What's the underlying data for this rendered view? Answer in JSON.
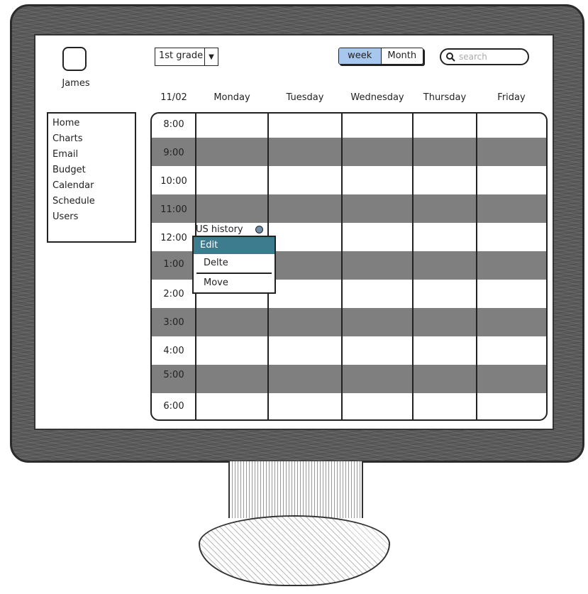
{
  "user": {
    "name": "James"
  },
  "toolbar": {
    "grade_value": "1st grade",
    "view_week": "week",
    "view_month": "Month",
    "active_view": "week",
    "search_placeholder": "search"
  },
  "nav": {
    "items": [
      "Home",
      "Charts",
      "Email",
      "Budget",
      "Calendar",
      "Schedule",
      "Users"
    ]
  },
  "calendar": {
    "date": "11/02",
    "days": [
      "Monday",
      "Tuesday",
      "Wednesday",
      "Thursday",
      "Friday"
    ],
    "times": [
      "8:00",
      "9:00",
      "10:00",
      "11:00",
      "12:00",
      "1:00",
      "2:00",
      "3:00",
      "4:00",
      "5:00",
      "6:00"
    ],
    "event": {
      "title": "US history",
      "day": "Monday",
      "time": "12:00"
    }
  },
  "context_menu": {
    "items": [
      "Edit",
      "Delte",
      "Move"
    ],
    "highlighted": "Edit"
  },
  "colors": {
    "accent_week": "#a8c7ef",
    "menu_highlight": "#3d7b8e",
    "band_gray": "#7f7f7f",
    "event_dot": "#6f8fa6"
  }
}
